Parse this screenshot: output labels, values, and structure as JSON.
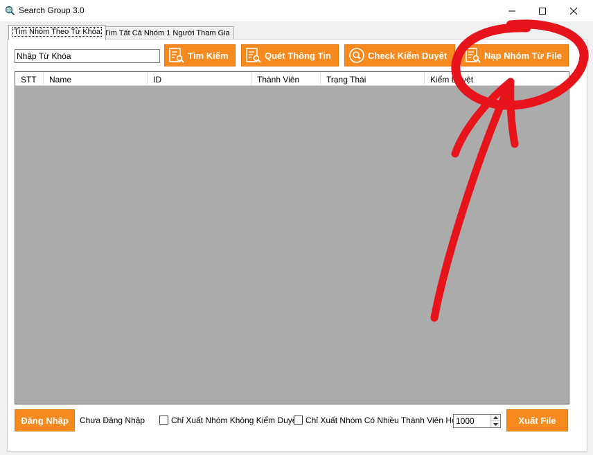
{
  "window": {
    "title": "Search Group 3.0",
    "icons": {
      "app": "globe-search-icon",
      "minimize": "minimize-icon",
      "maximize": "maximize-icon",
      "close": "close-icon"
    }
  },
  "tabs": [
    {
      "label": "Tìm Nhóm Theo Từ Khóa",
      "active": true
    },
    {
      "label": "Tìm Tất Cả Nhóm 1 Người Tham Gia",
      "active": false
    }
  ],
  "search": {
    "value": "Nhập Từ Khóa"
  },
  "toolbar": {
    "search_label": "Tìm Kiếm",
    "scan_label": "Quét Thông Tin",
    "check_label": "Check Kiểm Duyệt",
    "load_label": "Nạp Nhóm Từ File",
    "icons": {
      "search": "list-search-icon",
      "scan": "list-search-icon",
      "check": "magnifier-circle-icon",
      "load": "list-search-icon"
    }
  },
  "grid": {
    "columns": [
      "STT",
      "Name",
      "ID",
      "Thành Viên",
      "Trạng Thái",
      "Kiểm Duyệt"
    ],
    "rows": []
  },
  "footer": {
    "login_label": "Đăng Nhập",
    "status_text": "Chưa Đăng Nhập",
    "checkbox1_label": "Chỉ Xuất Nhóm Không Kiểm Duyệt",
    "checkbox1_checked": false,
    "checkbox2_label": "Chỉ Xuất Nhóm Có Nhiều Thành Viên Hơn",
    "checkbox2_checked": false,
    "member_threshold": "1000",
    "export_label": "Xuất File"
  },
  "colors": {
    "accent": "#f68a1e",
    "grid_bg": "#ababab",
    "annotation": "#e8141c"
  }
}
